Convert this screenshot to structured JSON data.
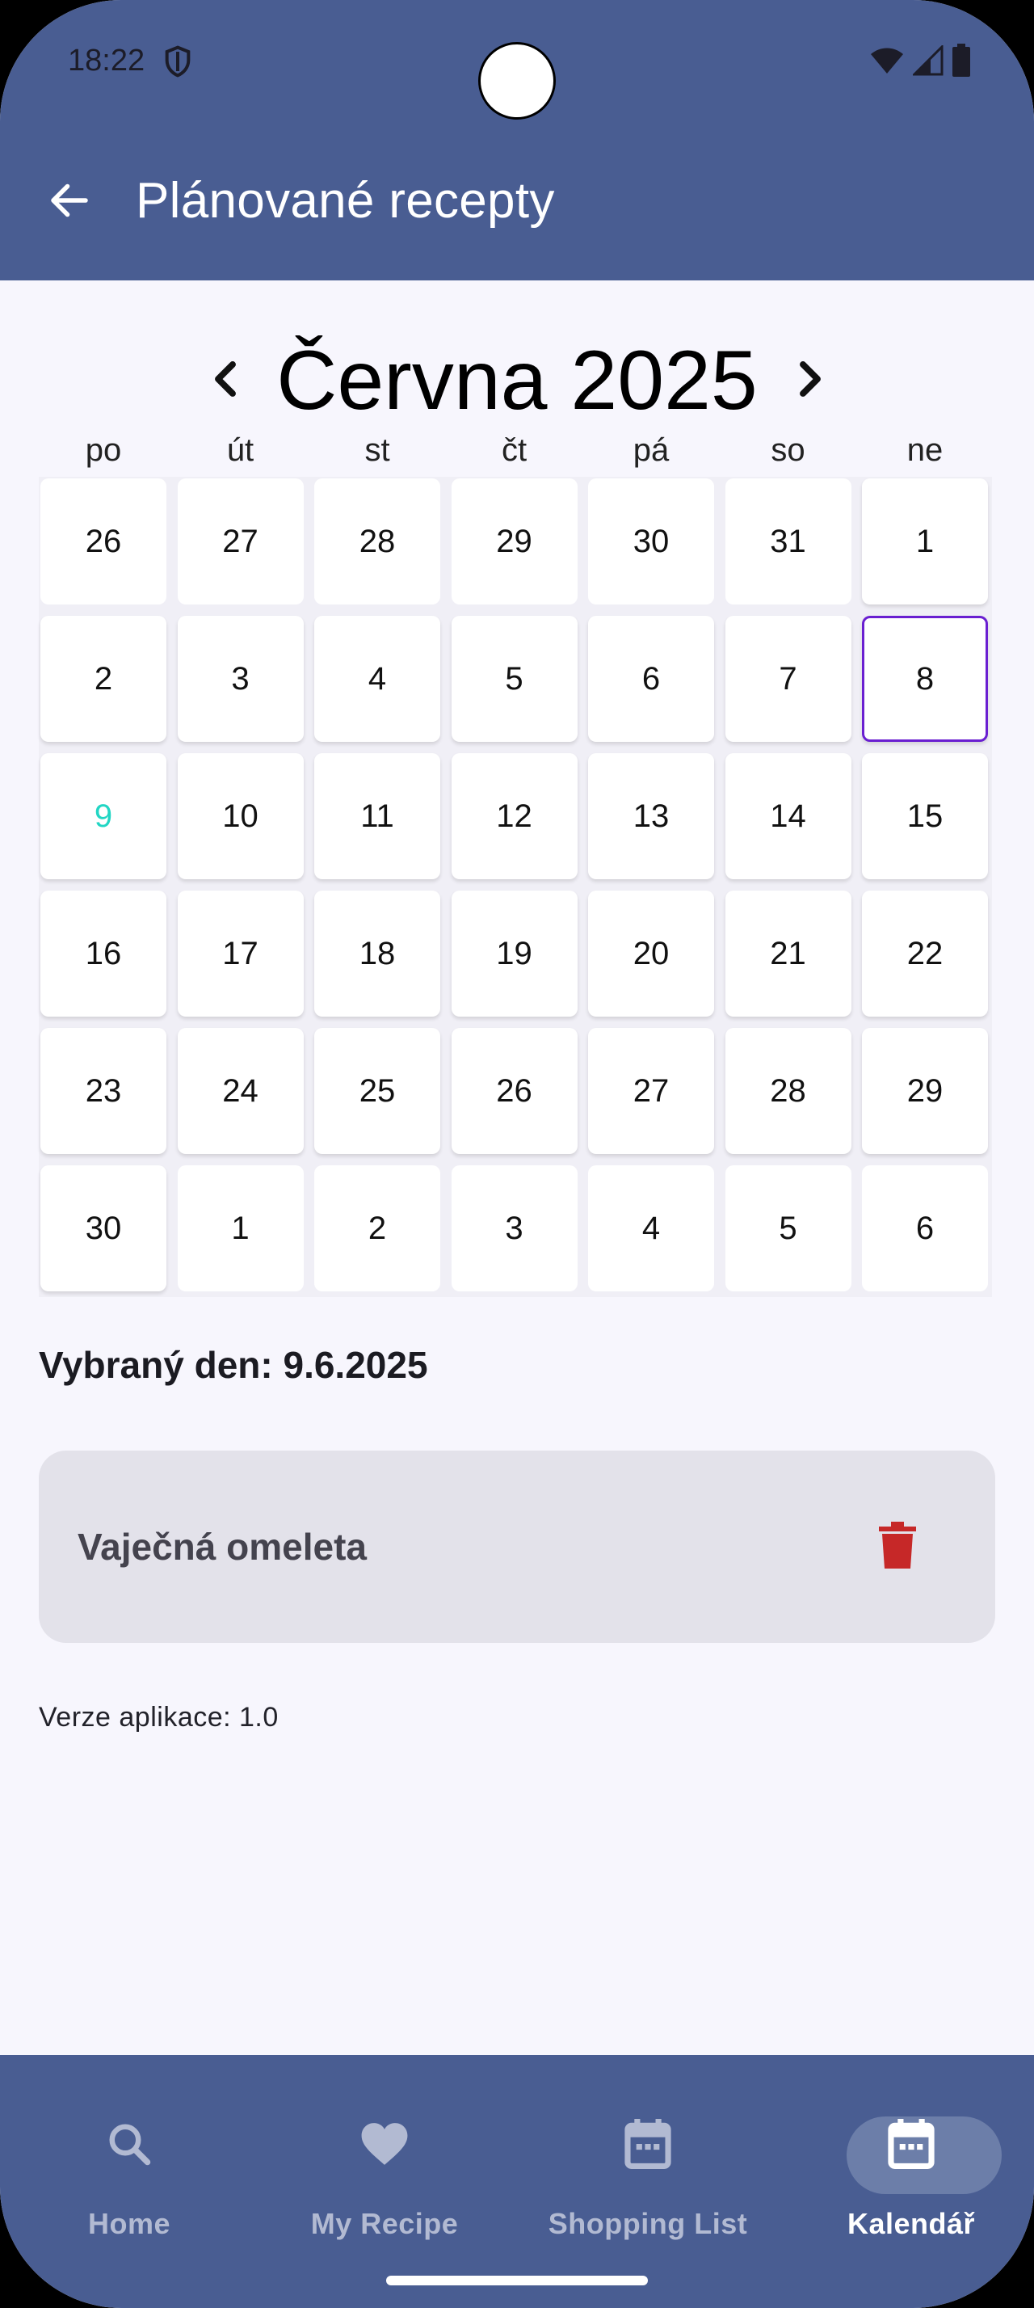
{
  "status_bar": {
    "time": "18:22",
    "icons": [
      "shield-icon",
      "wifi-icon",
      "signal-icon",
      "battery-icon"
    ]
  },
  "header": {
    "title": "Plánované recepty",
    "back_icon": "arrow-left-icon"
  },
  "calendar": {
    "month_title": "Června 2025",
    "weekdays": [
      "po",
      "út",
      "st",
      "čt",
      "pá",
      "so",
      "ne"
    ],
    "weeks": [
      [
        "26",
        "27",
        "28",
        "29",
        "30",
        "31",
        "1"
      ],
      [
        "2",
        "3",
        "4",
        "5",
        "6",
        "7",
        "8"
      ],
      [
        "9",
        "10",
        "11",
        "12",
        "13",
        "14",
        "15"
      ],
      [
        "16",
        "17",
        "18",
        "19",
        "20",
        "21",
        "22"
      ],
      [
        "23",
        "24",
        "25",
        "26",
        "27",
        "28",
        "29"
      ],
      [
        "30",
        "1",
        "2",
        "3",
        "4",
        "5",
        "6"
      ]
    ],
    "selected_cell": "8",
    "today_cell": "9",
    "colors": {
      "selected_border": "#6a1fd1",
      "today_text": "#22d6c4"
    }
  },
  "selected_day": {
    "text": "Vybraný den: 9.6.2025"
  },
  "recipes": [
    {
      "name": "Vaječná omeleta",
      "action_icon": "trash-icon"
    }
  ],
  "version": {
    "text": "Verze aplikace: 1.0"
  },
  "bottom_nav": {
    "items": [
      {
        "label": "Home",
        "icon": "search-icon"
      },
      {
        "label": "My Recipe",
        "icon": "heart-icon"
      },
      {
        "label": "Shopping List",
        "icon": "calendar-icon"
      },
      {
        "label": "Kalendář",
        "icon": "calendar-icon",
        "active": true
      }
    ]
  },
  "colors": {
    "primary": "#495d92",
    "background": "#f7f6fd",
    "card": "#e3e2ea",
    "delete": "#c62828"
  }
}
